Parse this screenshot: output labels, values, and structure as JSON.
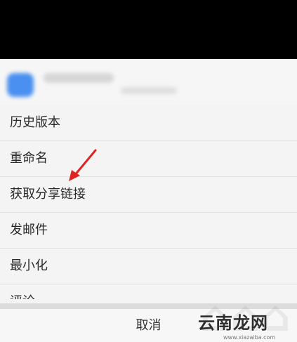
{
  "menu": {
    "items": [
      {
        "label": "历史版本"
      },
      {
        "label": "重命名"
      },
      {
        "label": "获取分享链接"
      },
      {
        "label": "发邮件"
      },
      {
        "label": "最小化"
      },
      {
        "label": "评论"
      }
    ]
  },
  "cancel": {
    "label": "取消"
  },
  "watermark": {
    "logo_text": "云南龙网",
    "url": "www.xiazaiba.com"
  },
  "colors": {
    "accent_arrow": "#e02424",
    "file_icon": "#4a90f0"
  },
  "icons": {
    "annotation_arrow": "red-arrow-icon",
    "file_type": "file-icon"
  }
}
